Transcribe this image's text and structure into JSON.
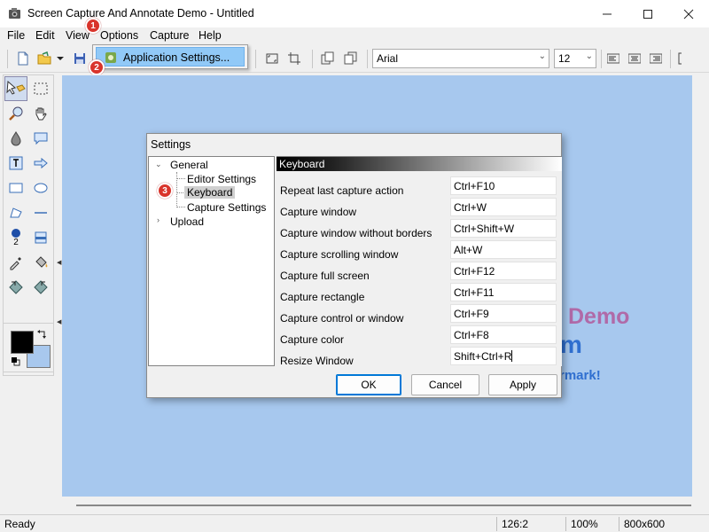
{
  "window": {
    "title": "Screen Capture And Annotate Demo - Untitled"
  },
  "menu": [
    "File",
    "Edit",
    "View",
    "Options",
    "Capture",
    "Help"
  ],
  "dropdown": {
    "item": "Application Settings..."
  },
  "badges": [
    "1",
    "2",
    "3"
  ],
  "toolbar": {
    "font": "Arial",
    "size": "12"
  },
  "watermark": [
    "Demo",
    "m",
    "rmark!"
  ],
  "palette": {
    "counter_label": "2"
  },
  "dialog": {
    "title": "Settings",
    "tree": {
      "general": "General",
      "editor": "Editor Settings",
      "keyboard": "Keyboard",
      "capture": "Capture Settings",
      "upload": "Upload"
    },
    "pane_title": "Keyboard",
    "rows": [
      {
        "label": "Repeat last capture action",
        "value": "Ctrl+F10"
      },
      {
        "label": "Capture window",
        "value": "Ctrl+W"
      },
      {
        "label": "Capture window without borders",
        "value": "Ctrl+Shift+W"
      },
      {
        "label": "Capture scrolling window",
        "value": "Alt+W"
      },
      {
        "label": "Capture full screen",
        "value": "Ctrl+F12"
      },
      {
        "label": "Capture rectangle",
        "value": "Ctrl+F11"
      },
      {
        "label": "Capture control or window",
        "value": "Ctrl+F9"
      },
      {
        "label": "Capture color",
        "value": "Ctrl+F8"
      },
      {
        "label": "Resize Window",
        "value": "Shift+Ctrl+R"
      }
    ],
    "buttons": {
      "ok": "OK",
      "cancel": "Cancel",
      "apply": "Apply"
    }
  },
  "status": {
    "state": "Ready",
    "coords": "126:2",
    "zoom": "100%",
    "size": "800x600"
  }
}
